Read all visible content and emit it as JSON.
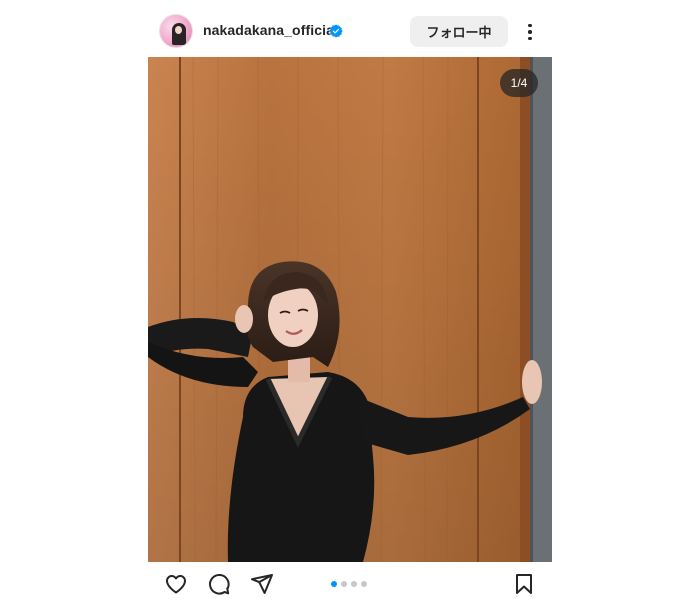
{
  "header": {
    "username": "nakadakana_official",
    "verified_icon": "verified-badge-icon",
    "follow_label": "フォロー中",
    "more_icon": "more-vertical-icon"
  },
  "post": {
    "image_counter": "1/4",
    "carousel": {
      "current": 1,
      "total": 4,
      "visible_dots": 4
    }
  },
  "actions": {
    "like_icon": "heart-icon",
    "comment_icon": "comment-icon",
    "share_icon": "share-icon",
    "save_icon": "bookmark-icon"
  },
  "colors": {
    "accent": "#0095f6",
    "verified": "#0095f6",
    "text": "#262626",
    "button_bg": "#efefef"
  }
}
